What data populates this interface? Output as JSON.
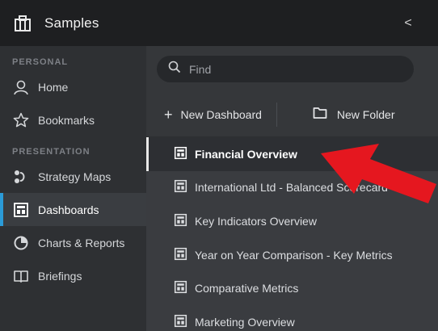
{
  "header": {
    "title": "Samples",
    "collapse_glyph": "<"
  },
  "sidebar": {
    "sections": [
      {
        "title": "PERSONAL"
      },
      {
        "title": "PRESENTATION"
      }
    ],
    "items": [
      {
        "label": "Home",
        "icon": "person-icon"
      },
      {
        "label": "Bookmarks",
        "icon": "star-icon"
      },
      {
        "label": "Strategy Maps",
        "icon": "strategy-map-icon"
      },
      {
        "label": "Dashboards",
        "icon": "dashboard-icon",
        "active": true
      },
      {
        "label": "Charts & Reports",
        "icon": "pie-chart-icon"
      },
      {
        "label": "Briefings",
        "icon": "book-icon"
      }
    ]
  },
  "main": {
    "search": {
      "placeholder": "Find"
    },
    "actions": {
      "new_dashboard": "New Dashboard",
      "new_folder": "New Folder"
    },
    "list": [
      {
        "label": "Financial Overview",
        "selected": true
      },
      {
        "label": "International Ltd - Balanced Scorecard"
      },
      {
        "label": "Key Indicators Overview"
      },
      {
        "label": "Year on Year Comparison - Key Metrics"
      },
      {
        "label": "Comparative Metrics"
      },
      {
        "label": "Marketing Overview"
      }
    ]
  },
  "colors": {
    "accent": "#2b9bd8",
    "annotation_arrow": "#e5171f"
  }
}
